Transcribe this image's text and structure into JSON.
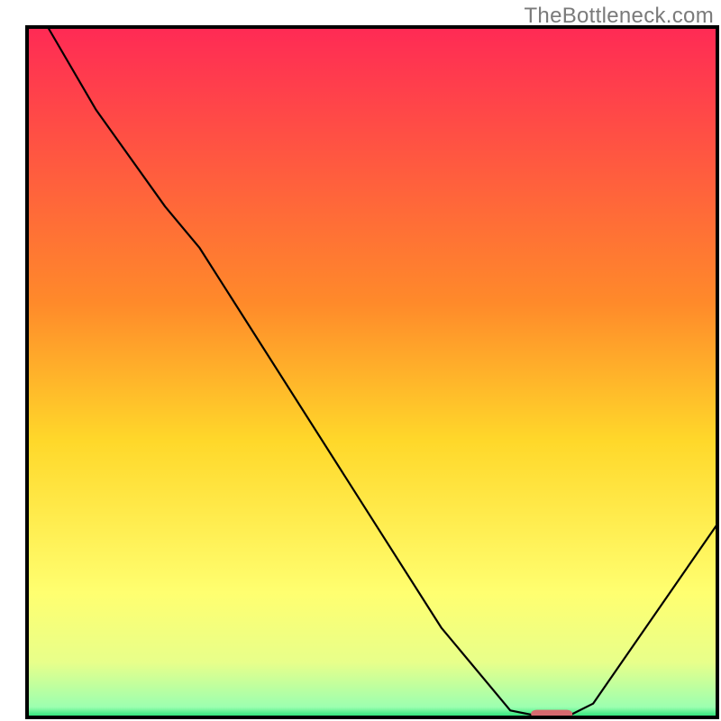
{
  "watermark": "TheBottleneck.com",
  "chart_data": {
    "type": "line",
    "title": "",
    "xlabel": "",
    "ylabel": "",
    "xlim": [
      0,
      100
    ],
    "ylim": [
      0,
      100
    ],
    "grid": false,
    "legend": false,
    "gradient_stops": [
      {
        "offset": 0,
        "color": "#ff2a55"
      },
      {
        "offset": 0.4,
        "color": "#ff8a2a"
      },
      {
        "offset": 0.6,
        "color": "#ffd82a"
      },
      {
        "offset": 0.82,
        "color": "#ffff70"
      },
      {
        "offset": 0.92,
        "color": "#e8ff8a"
      },
      {
        "offset": 0.985,
        "color": "#9cffb0"
      },
      {
        "offset": 1.0,
        "color": "#1fe074"
      }
    ],
    "series": [
      {
        "name": "bottleneck-curve",
        "x": [
          3,
          10,
          20,
          25,
          60,
          70,
          75,
          78,
          82,
          100
        ],
        "y": [
          100,
          88,
          74,
          68,
          13,
          1,
          0,
          0,
          2,
          28
        ]
      }
    ],
    "marker": {
      "name": "optimal-pill",
      "x": 76,
      "y": 0.5,
      "color": "#d66a6f",
      "width_pct": 6,
      "height_pct": 1.2
    },
    "frame_color": "#000000"
  }
}
